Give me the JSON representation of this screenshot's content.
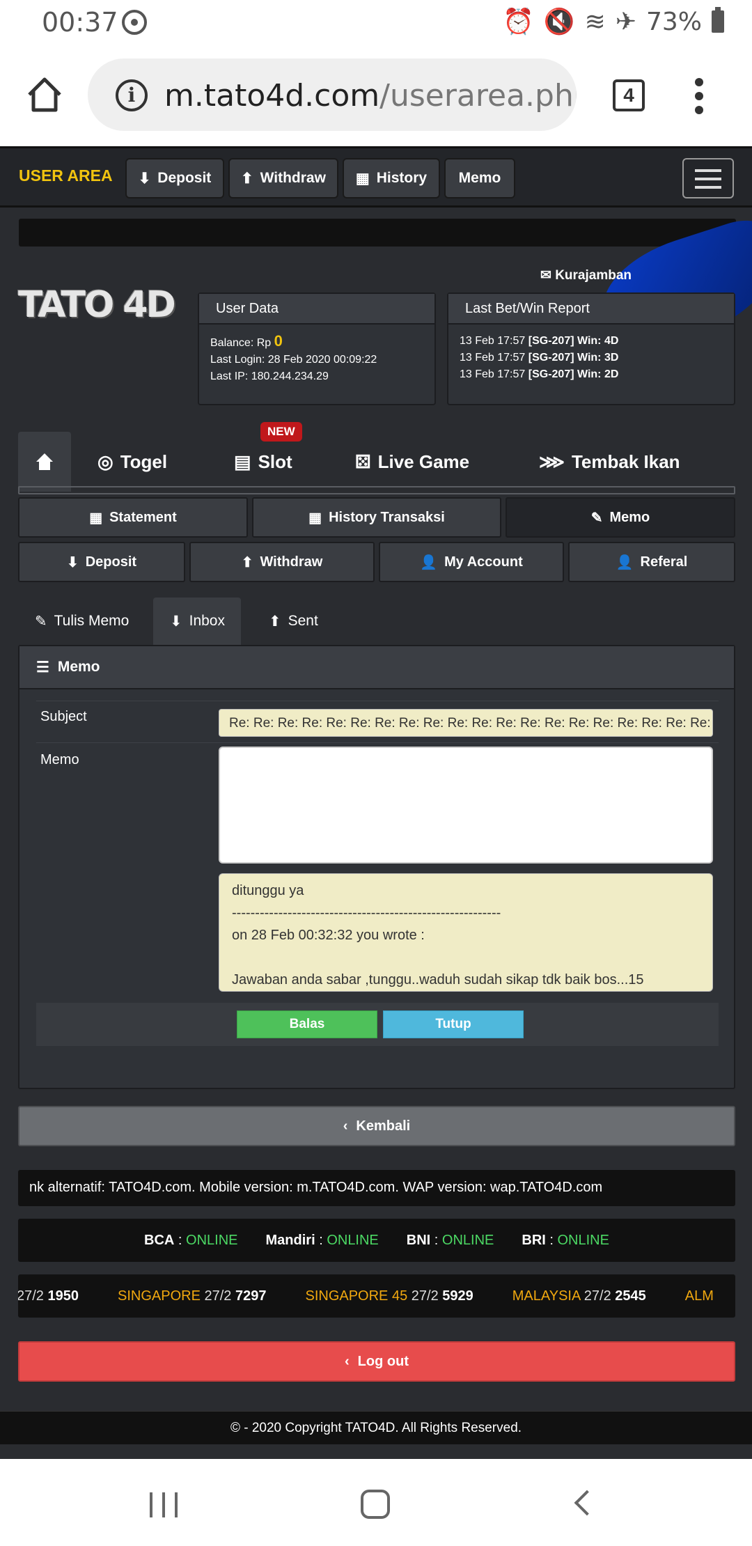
{
  "status_bar": {
    "time": "00:37",
    "battery": "73%"
  },
  "browser": {
    "url_domain": "m.tato4d.com",
    "url_path": "/userarea.php",
    "tab_count": "4"
  },
  "topnav": {
    "brand": "USER AREA",
    "buttons": [
      "Deposit",
      "Withdraw",
      "History",
      "Memo"
    ]
  },
  "header": {
    "mail_user": "Kurajamban",
    "logo_text": "TATO 4D",
    "user_data": {
      "title": "User Data",
      "balance_label": "Balance: Rp",
      "balance_value": "0",
      "last_login": "Last Login: 28 Feb 2020 00:09:22",
      "last_ip": "Last IP: 180.244.234.29"
    },
    "bet_report": {
      "title": "Last Bet/Win Report",
      "rows": [
        {
          "date": "13 Feb 17:57",
          "market": "[SG-207]",
          "result": "Win: 4D"
        },
        {
          "date": "13 Feb 17:57",
          "market": "[SG-207]",
          "result": "Win: 3D"
        },
        {
          "date": "13 Feb 17:57",
          "market": "[SG-207]",
          "result": "Win: 2D"
        }
      ]
    }
  },
  "game_tabs": {
    "togel": "Togel",
    "slot": "Slot",
    "new_badge": "NEW",
    "live": "Live Game",
    "tembak": "Tembak Ikan"
  },
  "sub_menu": {
    "statement": "Statement",
    "history_transaksi": "History Transaksi",
    "memo": "Memo",
    "deposit": "Deposit",
    "withdraw": "Withdraw",
    "my_account": "My Account",
    "referal": "Referal"
  },
  "memo_tabs": {
    "tulis": "Tulis Memo",
    "inbox": "Inbox",
    "sent": "Sent"
  },
  "memo_panel": {
    "title": "Memo",
    "subject_label": "Subject",
    "subject_value": "Re: Re: Re: Re: Re: Re: Re: Re: Re: Re: Re: Re: Re: Re: Re: Re: Re: Re: Re: Re: Re:",
    "memo_label": "Memo",
    "quote_lines": [
      "ditunggu ya",
      "----------------------------------------------------------",
      "on 28 Feb 00:32:32 you wrote :",
      "",
      "Jawaban anda sabar ,tunggu..waduh sudah sikap tdk baik bos...15"
    ],
    "reply_label": "Balas",
    "close_label": "Tutup"
  },
  "back_label": "Kembali",
  "marquee_text": "nk alternatif: TATO4D.com. Mobile version: m.TATO4D.com. WAP version: wap.TATO4D.com",
  "banks": [
    {
      "name": "BCA",
      "status": "ONLINE"
    },
    {
      "name": "Mandiri",
      "status": "ONLINE"
    },
    {
      "name": "BNI",
      "status": "ONLINE"
    },
    {
      "name": "BRI",
      "status": "ONLINE"
    }
  ],
  "results": [
    {
      "market": "",
      "date": "27/2",
      "number": "1950"
    },
    {
      "market": "SINGAPORE",
      "date": "27/2",
      "number": "7297"
    },
    {
      "market": "SINGAPORE 45",
      "date": "27/2",
      "number": "5929"
    },
    {
      "market": "MALAYSIA",
      "date": "27/2",
      "number": "2545"
    },
    {
      "market": "ALM",
      "date": "",
      "number": ""
    }
  ],
  "logout_label": "Log out",
  "footer": "© - 2020 Copyright TATO4D. All Rights Reserved."
}
